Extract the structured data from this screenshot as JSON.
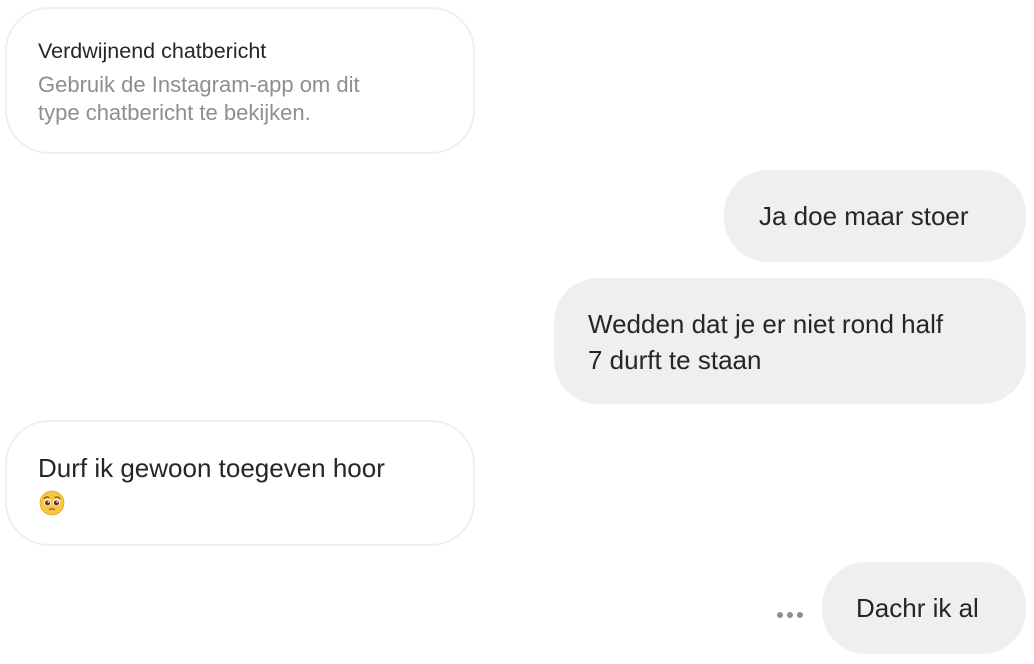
{
  "thread": {
    "disappearing_notice": {
      "title": "Verdwijnend chatbericht",
      "body_line1": "Gebruik de Instagram-app om dit",
      "body_line2": "type chatbericht te bekijken."
    },
    "messages": [
      {
        "direction": "outgoing",
        "text": "Ja doe maar stoer"
      },
      {
        "direction": "outgoing",
        "line1": "Wedden dat je er niet rond half",
        "line2": "7 durft te staan"
      },
      {
        "direction": "incoming",
        "text": "Durf ik gewoon toegeven hoor",
        "emoji": "pleading-face"
      },
      {
        "direction": "outgoing",
        "text": "Dachr ik al"
      }
    ],
    "more_options_icon": "ellipsis-icon"
  },
  "colors": {
    "background": "#ffffff",
    "outgoing_bubble": "#efefef",
    "incoming_border": "#efefef",
    "text": "#262626",
    "secondary_text": "#8e8e8e"
  }
}
